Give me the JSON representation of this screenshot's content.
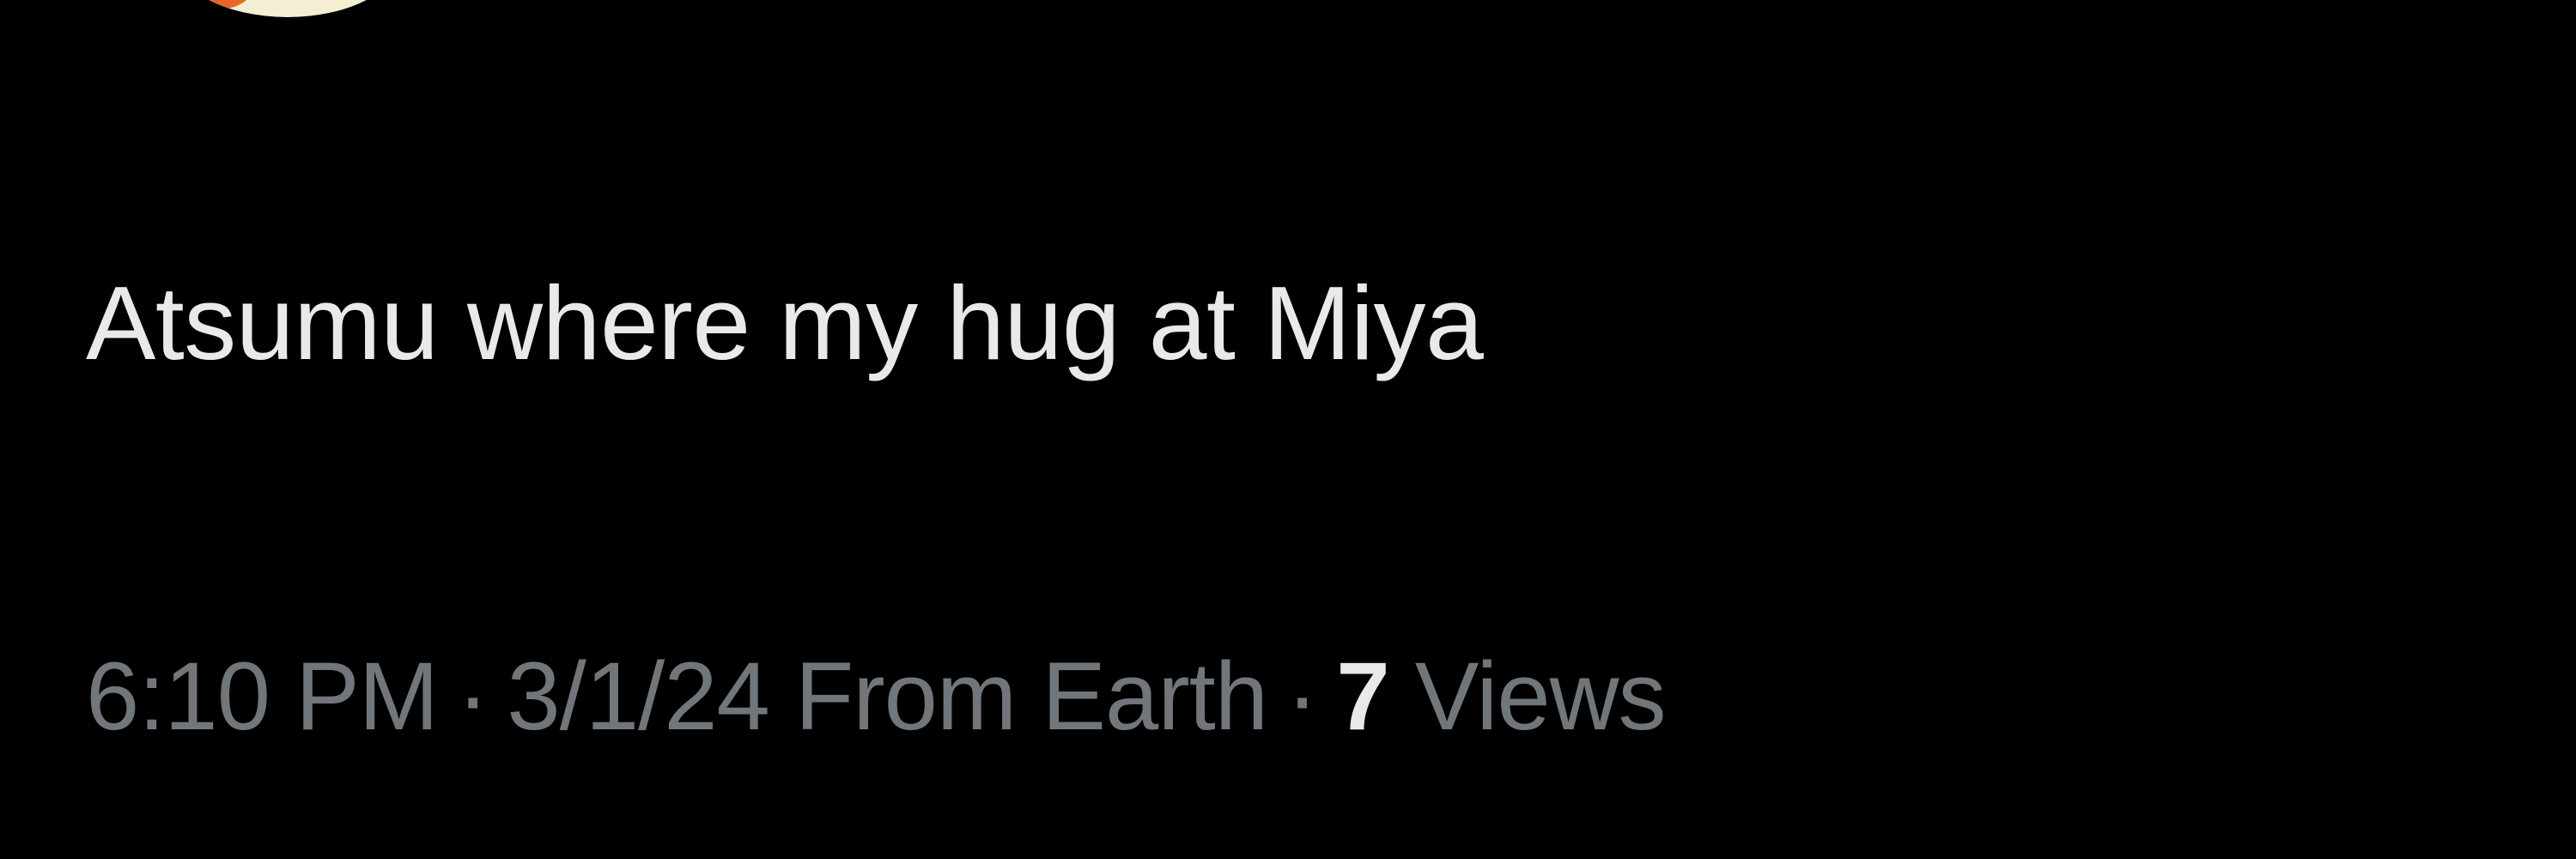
{
  "tweet": {
    "text": "Atsumu where my hug at Miya",
    "time": "6:10 PM",
    "date_source": "3/1/24 From Earth",
    "separator": "·",
    "views_count": "7",
    "views_label": "Views"
  },
  "colors": {
    "background": "#000000",
    "primary_text": "#e7e9ea",
    "secondary_text": "#71767b",
    "avatar_cream": "#f4efd2",
    "avatar_orange": "#e8662a"
  }
}
